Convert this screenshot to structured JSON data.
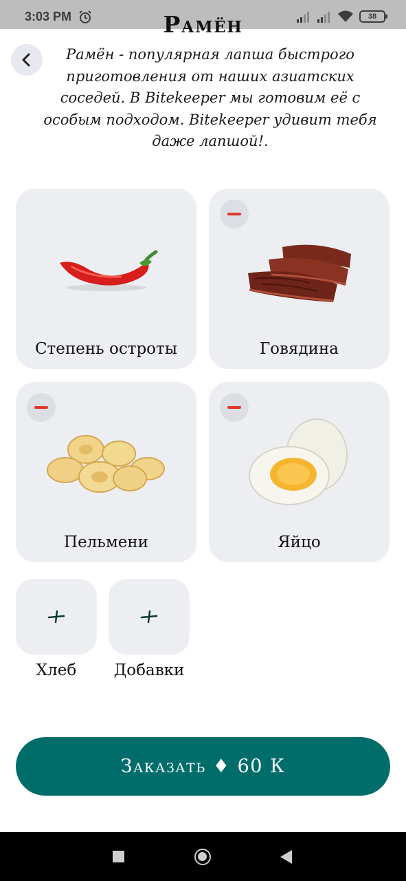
{
  "status_bar": {
    "time": "3:03 PM",
    "battery": "38",
    "icons": [
      "alarm-icon",
      "signal-icon",
      "signal-icon",
      "wifi-icon",
      "battery-icon"
    ]
  },
  "header": {
    "title": "Рамён",
    "back_icon": "chevron-left-icon",
    "description": "Рамён - популярная лапша быстрого приготовления от наших азиатских соседей. В Bitekeeper мы готовим её с особым подходом. Bitekeeper удивит тебя даже лапшой!."
  },
  "ingredients": [
    {
      "label": "Степень остроты",
      "icon": "chili-pepper-icon",
      "removable": false
    },
    {
      "label": "Говядина",
      "icon": "beef-icon",
      "removable": true
    },
    {
      "label": "Пельмени",
      "icon": "dumplings-icon",
      "removable": true
    },
    {
      "label": "Яйцо",
      "icon": "egg-icon",
      "removable": true
    }
  ],
  "extras": [
    {
      "label": "Хлеб",
      "icon": "plus-icon"
    },
    {
      "label": "Добавки",
      "icon": "plus-icon"
    }
  ],
  "order": {
    "label": "Заказать ♦ 60 К"
  },
  "colors": {
    "accent": "#006d6b",
    "card": "#eceef2",
    "remove": "#e0362c"
  },
  "nav_bar": {
    "icons": [
      "recents-icon",
      "home-icon",
      "back-icon"
    ]
  }
}
